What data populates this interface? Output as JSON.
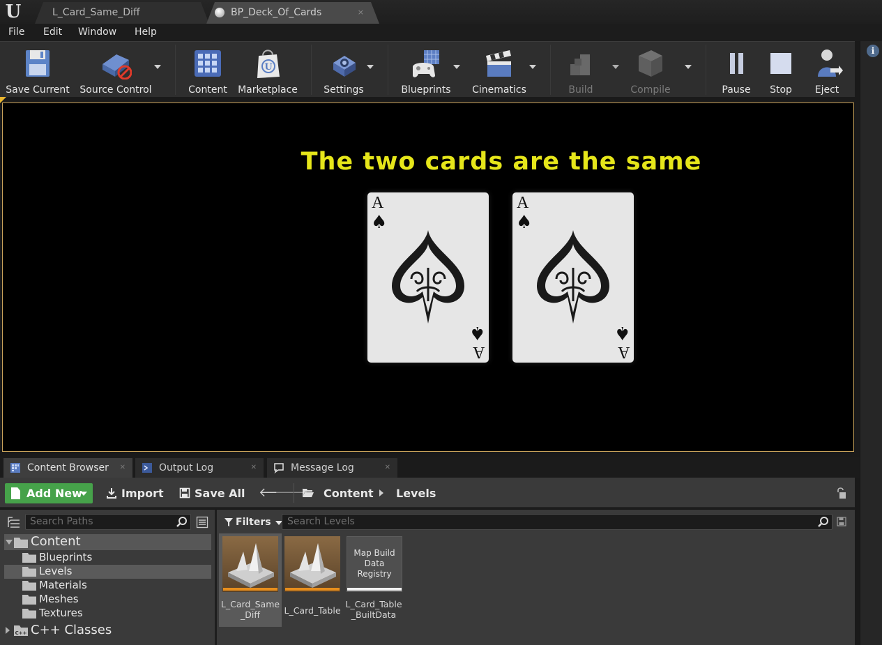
{
  "titlebar": {
    "tabs": [
      {
        "label": "L_Card_Same_Diff",
        "active": false
      },
      {
        "label": "BP_Deck_Of_Cards",
        "active": true,
        "close": "×"
      }
    ]
  },
  "menu": {
    "items": [
      {
        "label": "File"
      },
      {
        "label": "Edit"
      },
      {
        "label": "Window"
      },
      {
        "label": "Help"
      }
    ]
  },
  "toolbar": {
    "save_current": "Save Current",
    "source_control": "Source Control",
    "content": "Content",
    "marketplace": "Marketplace",
    "settings": "Settings",
    "blueprints": "Blueprints",
    "cinematics": "Cinematics",
    "build": "Build",
    "compile": "Compile",
    "pause": "Pause",
    "stop": "Stop",
    "eject": "Eject"
  },
  "viewport": {
    "message": "The two cards are the same",
    "message_color": "#e6e61a",
    "cards": [
      {
        "rank": "A",
        "suit": "♠"
      },
      {
        "rank": "A",
        "suit": "♠"
      }
    ]
  },
  "panel_tabs": [
    {
      "label": "Content Browser",
      "active": true
    },
    {
      "label": "Output Log",
      "active": false
    },
    {
      "label": "Message Log",
      "active": false
    }
  ],
  "content_browser": {
    "add_new": "Add New",
    "import": "Import",
    "save_all": "Save All",
    "breadcrumb": [
      "Content",
      "Levels"
    ],
    "accent_color": "#46a24a",
    "paths_search_placeholder": "Search Paths",
    "filters_label": "Filters",
    "assets_search_placeholder": "Search Levels",
    "tree": {
      "root": "Content",
      "children": [
        "Blueprints",
        "Levels",
        "Materials",
        "Meshes",
        "Textures"
      ],
      "selected": "Levels",
      "cpp": "C++ Classes"
    },
    "assets": [
      {
        "name": "L_Card_Same_Diff",
        "type": "level",
        "selected": true
      },
      {
        "name": "L_Card_Table",
        "type": "level",
        "selected": false
      },
      {
        "name": "L_Card_Table_BuiltData",
        "type": "registry",
        "thumb_text": "Map Build Data Registry",
        "selected": false
      }
    ]
  }
}
